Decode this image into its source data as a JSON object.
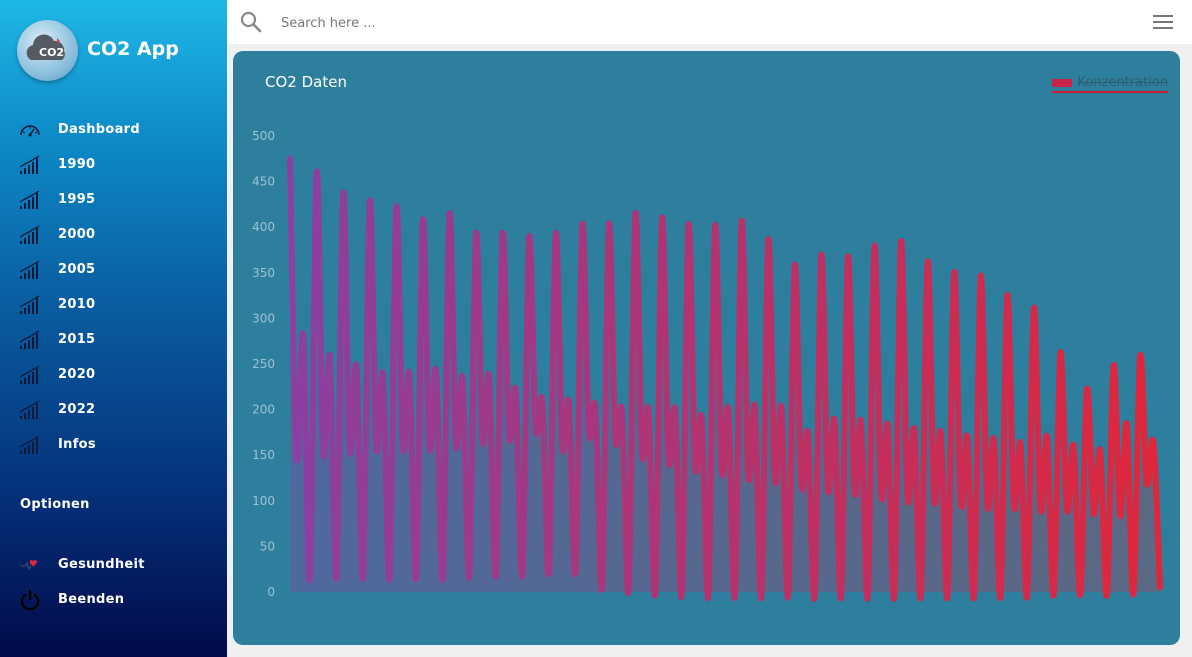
{
  "app": {
    "title": "CO2 App",
    "logo_text": "CO2"
  },
  "sidebar": {
    "items": [
      {
        "label": "Dashboard",
        "icon": "speedometer-icon"
      },
      {
        "label": "1990",
        "icon": "chart-icon"
      },
      {
        "label": "1995",
        "icon": "chart-icon"
      },
      {
        "label": "2000",
        "icon": "chart-icon"
      },
      {
        "label": "2005",
        "icon": "chart-icon"
      },
      {
        "label": "2010",
        "icon": "chart-icon"
      },
      {
        "label": "2015",
        "icon": "chart-icon"
      },
      {
        "label": "2020",
        "icon": "chart-icon"
      },
      {
        "label": "2022",
        "icon": "chart-icon"
      },
      {
        "label": "Infos",
        "icon": "chart-icon"
      }
    ],
    "section_label": "Optionen",
    "options": [
      {
        "label": "Gesundheit",
        "icon": "heartbeat-icon"
      },
      {
        "label": "Beenden",
        "icon": "power-icon"
      }
    ]
  },
  "topbar": {
    "search_placeholder": "Search here ..."
  },
  "card": {
    "title": "CO2 Daten"
  },
  "colors": {
    "line_start": "#8b3fa0",
    "line_end": "#e0263a",
    "card_bg": "#2e7f9d"
  },
  "chart_data": {
    "type": "line",
    "title": "",
    "legend": [
      "Konzentration"
    ],
    "legend_position": "top-right",
    "xlabel": "",
    "ylabel": "",
    "ylim": [
      0,
      500
    ],
    "yticks": [
      0,
      50,
      100,
      150,
      200,
      250,
      300,
      350,
      400,
      450,
      500
    ],
    "grid": false,
    "series": [
      {
        "name": "Konzentration",
        "values": [
          475,
          148,
          282,
          15,
          460,
          153,
          258,
          17,
          437,
          156,
          247,
          17,
          428,
          159,
          238,
          16,
          421,
          159,
          239,
          16,
          407,
          159,
          242,
          16,
          414,
          162,
          234,
          18,
          392,
          166,
          236,
          19,
          392,
          171,
          220,
          20,
          388,
          180,
          209,
          23,
          392,
          160,
          208,
          23,
          402,
          176,
          202,
          6,
          402,
          169,
          198,
          3,
          414,
          153,
          199,
          0,
          409,
          146,
          199,
          -2,
          402,
          139,
          191,
          -3,
          401,
          134,
          200,
          -3,
          406,
          128,
          203,
          -4,
          386,
          124,
          202,
          -4,
          358,
          118,
          174,
          -4,
          369,
          114,
          188,
          -4,
          367,
          111,
          187,
          -4,
          379,
          107,
          183,
          -4,
          384,
          104,
          178,
          -4,
          362,
          102,
          175,
          -4,
          350,
          98,
          170,
          -4,
          346,
          96,
          167,
          -4,
          325,
          95,
          163,
          -4,
          311,
          91,
          170,
          -3,
          262,
          90,
          160,
          -3,
          222,
          86,
          155,
          -3,
          248,
          84,
          184,
          -2,
          258,
          120,
          164,
          5
        ]
      }
    ]
  }
}
